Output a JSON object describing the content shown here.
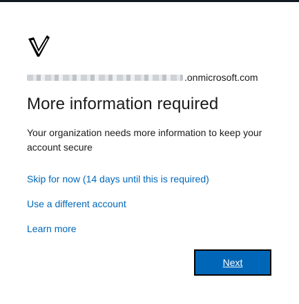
{
  "header": {
    "logo_icon": "shield-check-icon"
  },
  "account": {
    "email_domain": ".onmicrosoft.com"
  },
  "main": {
    "title": "More information required",
    "description": "Your organization needs more information to keep your account secure",
    "links": {
      "skip": "Skip for now (14 days until this is required)",
      "different_account": "Use a different account",
      "learn_more": "Learn more"
    },
    "next_button": "Next"
  },
  "colors": {
    "accent": "#0067b8",
    "text": "#1b1b1b",
    "background": "#ffffff",
    "top_bar": "#111a22"
  }
}
